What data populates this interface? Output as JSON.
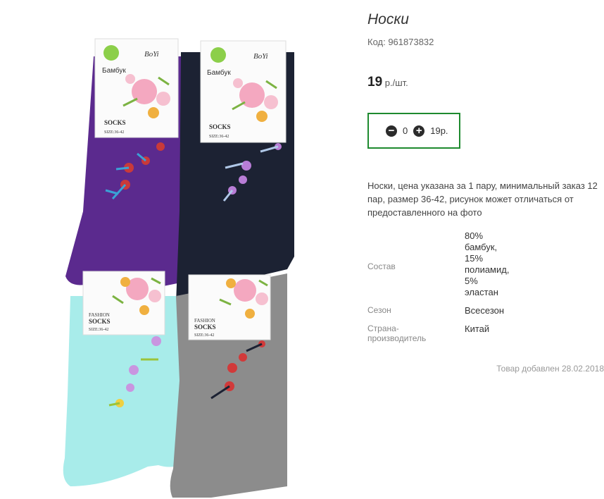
{
  "product": {
    "title": "Носки",
    "code_text": "Код: 961873832",
    "price_value": "19",
    "price_unit": " р./шт.",
    "quantity": "0",
    "total": "19р.",
    "description": "Носки, цена указана за 1 пару, минимальный заказ 12 пар, размер 36-42, рисунок может отличаться от предоставленного на фото",
    "added_text": "Товар добавлен 28.02.2018"
  },
  "properties": [
    {
      "key": "Состав",
      "value_lines": [
        "80%",
        "бамбук,",
        "15%",
        "полиамид,",
        "5%",
        "эластан"
      ]
    },
    {
      "key": "Сезон",
      "value_lines": [
        "Всесезон"
      ]
    },
    {
      "key": "Страна-производитель",
      "value_lines": [
        "Китай"
      ]
    }
  ],
  "labels": {
    "bamboo": "Бамбук",
    "brand": "BoYi",
    "fashion": "FASHION",
    "socks": "SOCKS",
    "size": "SIZE:36-42"
  },
  "colors": {
    "accent_border": "#1e8a2f",
    "purple_sock": "#5b2a8e",
    "navy_sock": "#1c2233",
    "mint_sock": "#a8ecea",
    "gray_sock": "#8c8c8c"
  },
  "icons": [
    "minus-circle-icon",
    "plus-circle-icon"
  ]
}
